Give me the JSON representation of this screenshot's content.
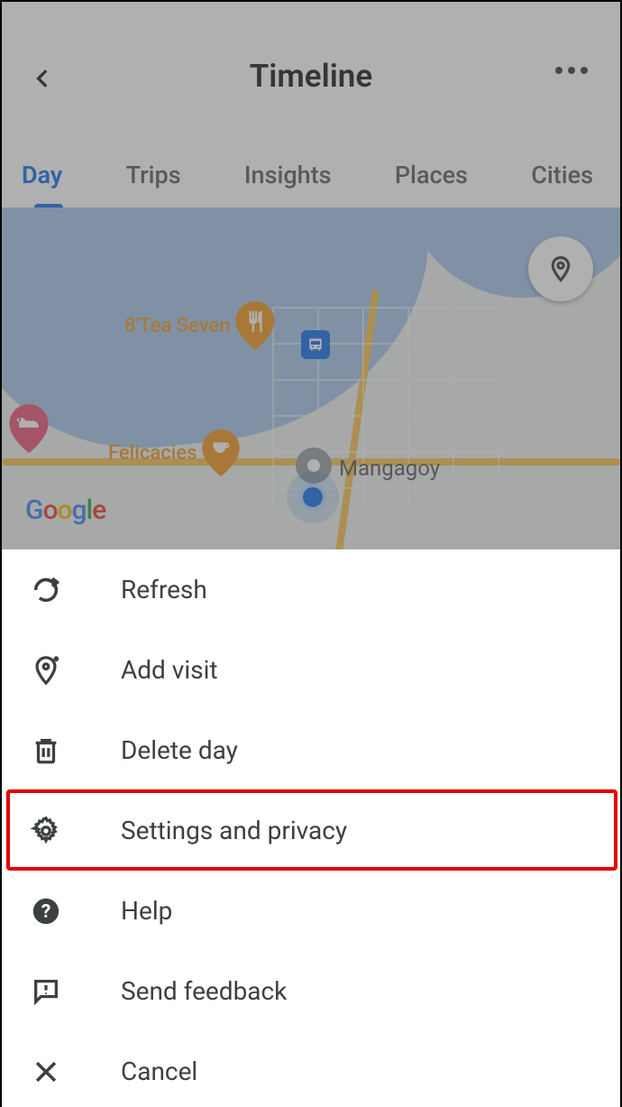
{
  "header": {
    "title": "Timeline"
  },
  "tabs": {
    "items": [
      "Day",
      "Trips",
      "Insights",
      "Places",
      "Cities"
    ],
    "active_index": 0
  },
  "map": {
    "pois": {
      "tea": "8'Tea Seven",
      "felicacies": "Felicacies",
      "mangagoy": "Mangagoy"
    },
    "provider": "Google"
  },
  "menu": {
    "items": [
      {
        "id": "refresh",
        "label": "Refresh"
      },
      {
        "id": "add-visit",
        "label": "Add visit"
      },
      {
        "id": "delete-day",
        "label": "Delete day"
      },
      {
        "id": "settings",
        "label": "Settings and privacy"
      },
      {
        "id": "help",
        "label": "Help"
      },
      {
        "id": "feedback",
        "label": "Send feedback"
      },
      {
        "id": "cancel",
        "label": "Cancel"
      }
    ],
    "highlighted_index": 3
  }
}
